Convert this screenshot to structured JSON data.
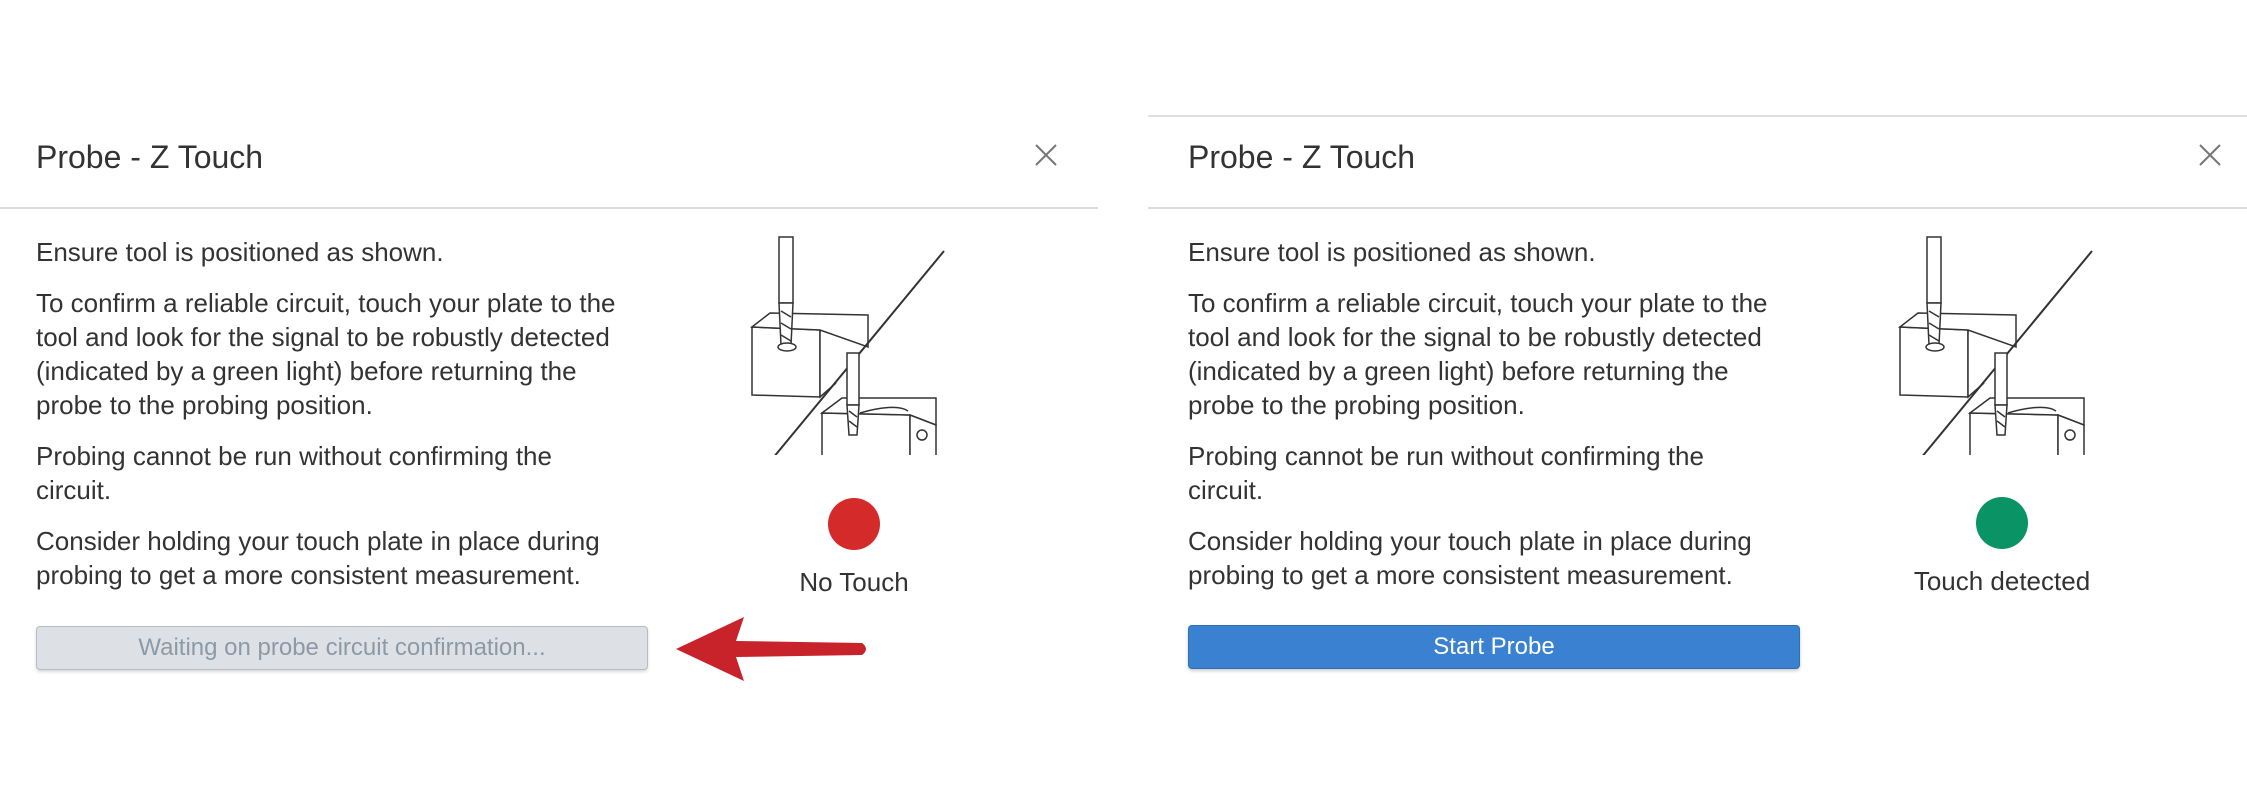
{
  "colors": {
    "no_touch": "#d42a2a",
    "touch_detected": "#0a9465",
    "primary_button": "#3a82d1",
    "disabled_button": "#dde1e6",
    "arrow": "#c8222a"
  },
  "panels": [
    {
      "title": "Probe - Z Touch",
      "paragraphs": [
        "Ensure tool is positioned as shown.",
        "To confirm a reliable circuit, touch your plate to the tool and look for the signal to be robustly detected (indicated by a green light) before returning the probe to the probing position.",
        "Probing cannot be run without confirming the circuit.",
        "Consider holding your touch plate in place during probing to get a more consistent measurement."
      ],
      "status_label": "No Touch",
      "status_state": "no-touch",
      "button_label": "Waiting on probe circuit confirmation...",
      "button_state": "disabled"
    },
    {
      "title": "Probe - Z Touch",
      "paragraphs": [
        "Ensure tool is positioned as shown.",
        "To confirm a reliable circuit, touch your plate to the tool and look for the signal to be robustly detected (indicated by a green light) before returning the probe to the probing position.",
        "Probing cannot be run without confirming the circuit.",
        "Consider holding your touch plate in place during probing to get a more consistent measurement."
      ],
      "status_label": "Touch detected",
      "status_state": "touch-detected",
      "button_label": "Start Probe",
      "button_state": "enabled"
    }
  ]
}
